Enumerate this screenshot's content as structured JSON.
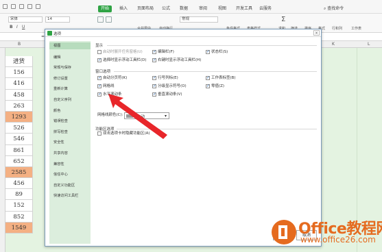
{
  "ribbon": {
    "tabs": [
      "开始",
      "插入",
      "页面布局",
      "公式",
      "数据",
      "审阅",
      "视图",
      "开发工具",
      "云服务"
    ],
    "active_tab": "开始",
    "search_placeholder": "查找命令",
    "font_name": "宋体",
    "font_size": "14",
    "number_format": "常规",
    "labels": {
      "merge": "合并居中",
      "wrap": "自动换行",
      "cond_format": "条件格式",
      "table_style": "表格样式",
      "sum": "求和",
      "filter": "筛选",
      "sort": "排序",
      "format": "格式",
      "rowcol": "行和列",
      "sheet": "工作表"
    },
    "formula_bar_prefix": "=INI"
  },
  "sheet": {
    "col_headers": [
      "B",
      "K",
      "L"
    ],
    "header_cell": "进货",
    "values": [
      {
        "v": "156",
        "hl": false
      },
      {
        "v": "416",
        "hl": false
      },
      {
        "v": "458",
        "hl": false
      },
      {
        "v": "263",
        "hl": false
      },
      {
        "v": "1293",
        "hl": true
      },
      {
        "v": "526",
        "hl": false
      },
      {
        "v": "546",
        "hl": false
      },
      {
        "v": "861",
        "hl": false
      },
      {
        "v": "652",
        "hl": false
      },
      {
        "v": "2585",
        "hl": true
      },
      {
        "v": "456",
        "hl": false
      },
      {
        "v": "89",
        "hl": false
      },
      {
        "v": "152",
        "hl": false
      },
      {
        "v": "852",
        "hl": false
      },
      {
        "v": "1549",
        "hl": true
      }
    ],
    "highlight_color": "#f4b083"
  },
  "dialog": {
    "title": "选项",
    "close": "×",
    "nav": [
      "视图",
      "编辑",
      "常规与保存",
      "修订设置",
      "重新计算",
      "自定义序列",
      "颜色",
      "错误检查",
      "拼写检查",
      "安全性",
      "共享内容",
      "兼容性",
      "信任中心",
      "自定义功能区",
      "快速访问工具栏"
    ],
    "selected_nav": "视图",
    "sections": {
      "display": "显示",
      "window": "窗口选项",
      "ribbon": "功能区选项"
    },
    "display_options": [
      {
        "label": "启动时展开任务窗格(U)",
        "checked": false,
        "disabled": true
      },
      {
        "label": "编辑栏(F)",
        "checked": true,
        "disabled": false
      },
      {
        "label": "状态栏(S)",
        "checked": true,
        "disabled": false
      },
      {
        "label": "选择时显示浮动工具栏(D)",
        "checked": true,
        "disabled": false
      },
      {
        "label": "右键时显示浮动工具栏(H)",
        "checked": true,
        "disabled": false
      }
    ],
    "window_options": [
      {
        "label": "自动分页符(K)",
        "checked": true
      },
      {
        "label": "行号列标(E)",
        "checked": true
      },
      {
        "label": "工作表标签(B)",
        "checked": true
      },
      {
        "label": "网格线",
        "checked": true
      },
      {
        "label": "分级显示符号(O)",
        "checked": true
      },
      {
        "label": "零值(Z)",
        "checked": true
      },
      {
        "label": "水平滚动条",
        "checked": true
      },
      {
        "label": "垂直滚动条(V)",
        "checked": true
      }
    ],
    "grid_color_label": "网格线颜色(C):",
    "grid_color_value": "自动",
    "ribbon_options": [
      {
        "label": "双击选项卡时隐藏功能区(A)",
        "checked": false
      }
    ],
    "buttons": {
      "ok": "确定",
      "cancel": "取消"
    }
  },
  "watermark": {
    "name": "Office教程网",
    "url": "www.office26.com",
    "color": "#e56b1f"
  },
  "arrow_color": "#e8262a"
}
